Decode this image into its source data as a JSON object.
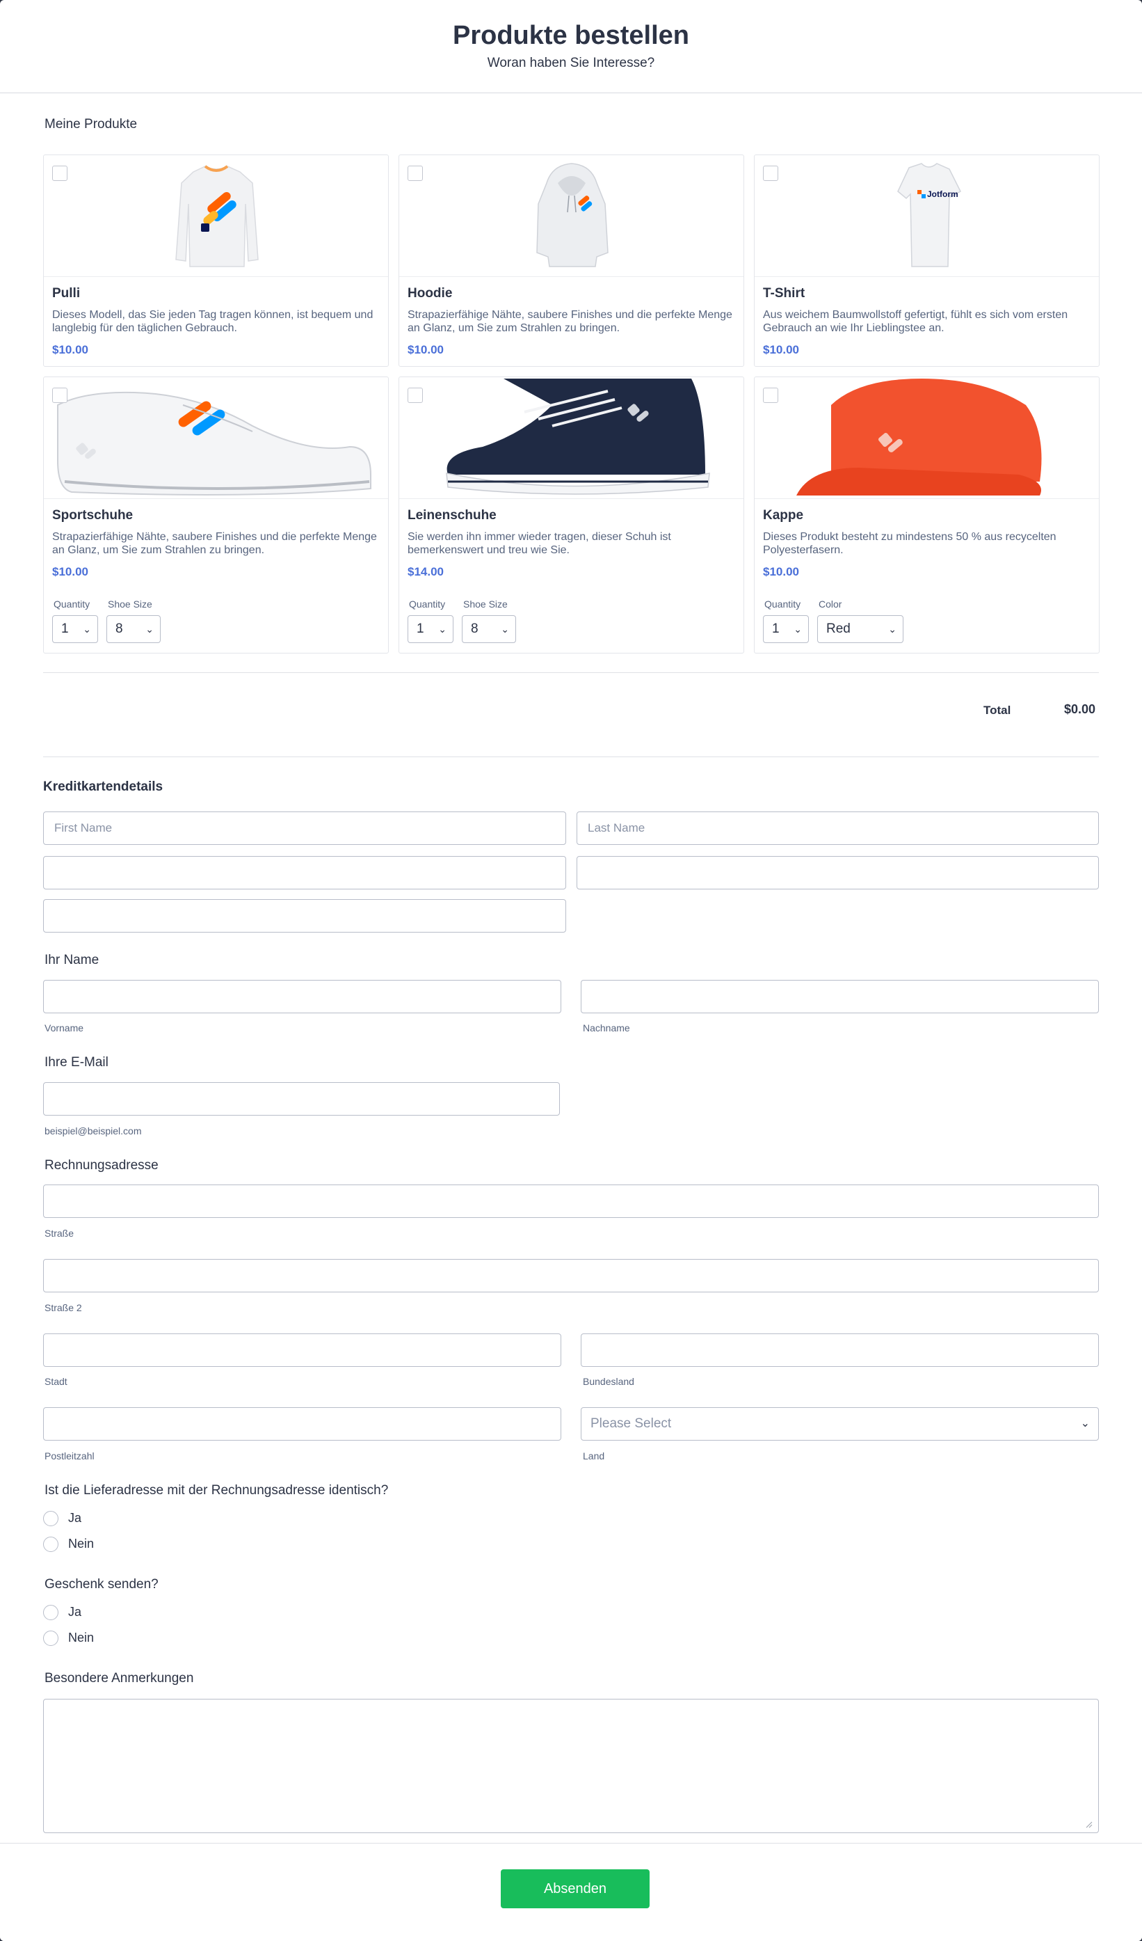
{
  "header": {
    "title": "Produkte bestellen",
    "subtitle": "Woran haben Sie Interesse?"
  },
  "products_label": "Meine Produkte",
  "products": [
    {
      "name": "Pulli",
      "desc": "Dieses Modell, das Sie jeden Tag tragen können, ist bequem und langlebig für den täglichen Gebrauch.",
      "price": "$10.00"
    },
    {
      "name": "Hoodie",
      "desc": "Strapazierfähige Nähte, saubere Finishes und die perfekte Menge an Glanz, um Sie zum Strahlen zu bringen.",
      "price": "$10.00"
    },
    {
      "name": "T-Shirt",
      "desc": "Aus weichem Baumwollstoff gefertigt, fühlt es sich vom ersten Gebrauch an wie Ihr Lieblingstee an.",
      "price": "$10.00",
      "logo_text": "Jotform"
    },
    {
      "name": "Sportschuhe",
      "desc": "Strapazierfähige Nähte, saubere Finishes und die perfekte Menge an Glanz, um Sie zum Strahlen zu bringen.",
      "price": "$10.00",
      "opt1_label": "Quantity",
      "opt1_value": "1",
      "opt2_label": "Shoe Size",
      "opt2_value": "8"
    },
    {
      "name": "Leinenschuhe",
      "desc": "Sie werden ihn immer wieder tragen, dieser Schuh ist bemerkenswert und treu wie Sie.",
      "price": "$14.00",
      "opt1_label": "Quantity",
      "opt1_value": "1",
      "opt2_label": "Shoe Size",
      "opt2_value": "8"
    },
    {
      "name": "Kappe",
      "desc": "Dieses Produkt besteht zu mindestens 50 % aus recycelten Polyesterfasern.",
      "price": "$10.00",
      "opt1_label": "Quantity",
      "opt1_value": "1",
      "opt2_label": "Color",
      "opt2_value": "Red"
    }
  ],
  "total": {
    "label": "Total",
    "value": "$0.00"
  },
  "credit_card": {
    "title": "Kreditkartendetails",
    "first_name_placeholder": "First Name",
    "last_name_placeholder": "Last Name"
  },
  "name_section": {
    "label": "Ihr Name",
    "first": "Vorname",
    "last": "Nachname"
  },
  "email_section": {
    "label": "Ihre E-Mail",
    "hint": "beispiel@beispiel.com"
  },
  "address": {
    "label": "Rechnungsadresse",
    "street": "Straße",
    "street2": "Straße 2",
    "city": "Stadt",
    "state": "Bundesland",
    "zip": "Postleitzahl",
    "country": "Land",
    "country_placeholder": "Please Select"
  },
  "same_address": {
    "question": "Ist die Lieferadresse mit der Rechnungsadresse identisch?",
    "yes": "Ja",
    "no": "Nein"
  },
  "gift": {
    "question": "Geschenk senden?",
    "yes": "Ja",
    "no": "Nein"
  },
  "notes": {
    "label": "Besondere Anmerkungen"
  },
  "submit_label": "Absenden",
  "colors": {
    "accent_price": "#4a6fd8",
    "submit": "#18bd5b",
    "backdrop": "#2f3542"
  },
  "icons": [
    "checkbox",
    "chevron-down-icon",
    "radio",
    "resize-handle-icon"
  ]
}
